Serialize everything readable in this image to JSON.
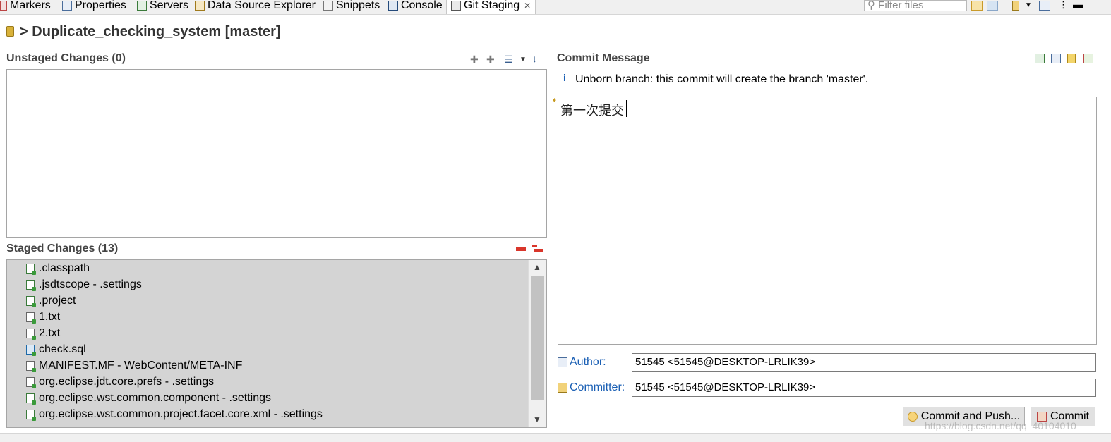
{
  "tabs": [
    {
      "label": "Markers"
    },
    {
      "label": "Properties"
    },
    {
      "label": "Servers"
    },
    {
      "label": "Data Source Explorer"
    },
    {
      "label": "Snippets"
    },
    {
      "label": "Console"
    },
    {
      "label": "Git Staging"
    }
  ],
  "filter": {
    "placeholder": "Filter files"
  },
  "header": {
    "prefix": ">",
    "repo": "Duplicate_checking_system [master]"
  },
  "unstaged": {
    "title": "Unstaged Changes (0)"
  },
  "staged": {
    "title": "Staged Changes (13)",
    "files": [
      {
        "name": ".classpath",
        "icon": "xml-file-icon"
      },
      {
        "name": ".jsdtscope - .settings",
        "icon": "xml-file-icon"
      },
      {
        "name": ".project",
        "icon": "xml-file-icon"
      },
      {
        "name": "1.txt",
        "icon": "text-file-icon"
      },
      {
        "name": "2.txt",
        "icon": "text-file-icon"
      },
      {
        "name": "check.sql",
        "icon": "sql-file-icon"
      },
      {
        "name": "MANIFEST.MF - WebContent/META-INF",
        "icon": "text-file-icon"
      },
      {
        "name": "org.eclipse.jdt.core.prefs - .settings",
        "icon": "text-file-icon"
      },
      {
        "name": "org.eclipse.wst.common.component - .settings",
        "icon": "xml-file-icon"
      },
      {
        "name": "org.eclipse.wst.common.project.facet.core.xml - .settings",
        "icon": "xml-file-icon"
      }
    ]
  },
  "commit": {
    "title": "Commit Message",
    "info": "Unborn branch: this commit will create the branch 'master'.",
    "message": "第一次提交",
    "author_label": "Author:",
    "author": "51545 <51545@DESKTOP-LRLIK39>",
    "committer_label": "Committer:",
    "committer": "51545 <51545@DESKTOP-LRLIK39>",
    "commit_push_label": "Commit and Push...",
    "commit_label": "Commit"
  },
  "watermark": "https://blog.csdn.net/qq_40104010",
  "colors": {
    "link_blue": "#1a5fb4",
    "list_bg": "#d4d4d4",
    "remove_red": "#d9362b"
  }
}
